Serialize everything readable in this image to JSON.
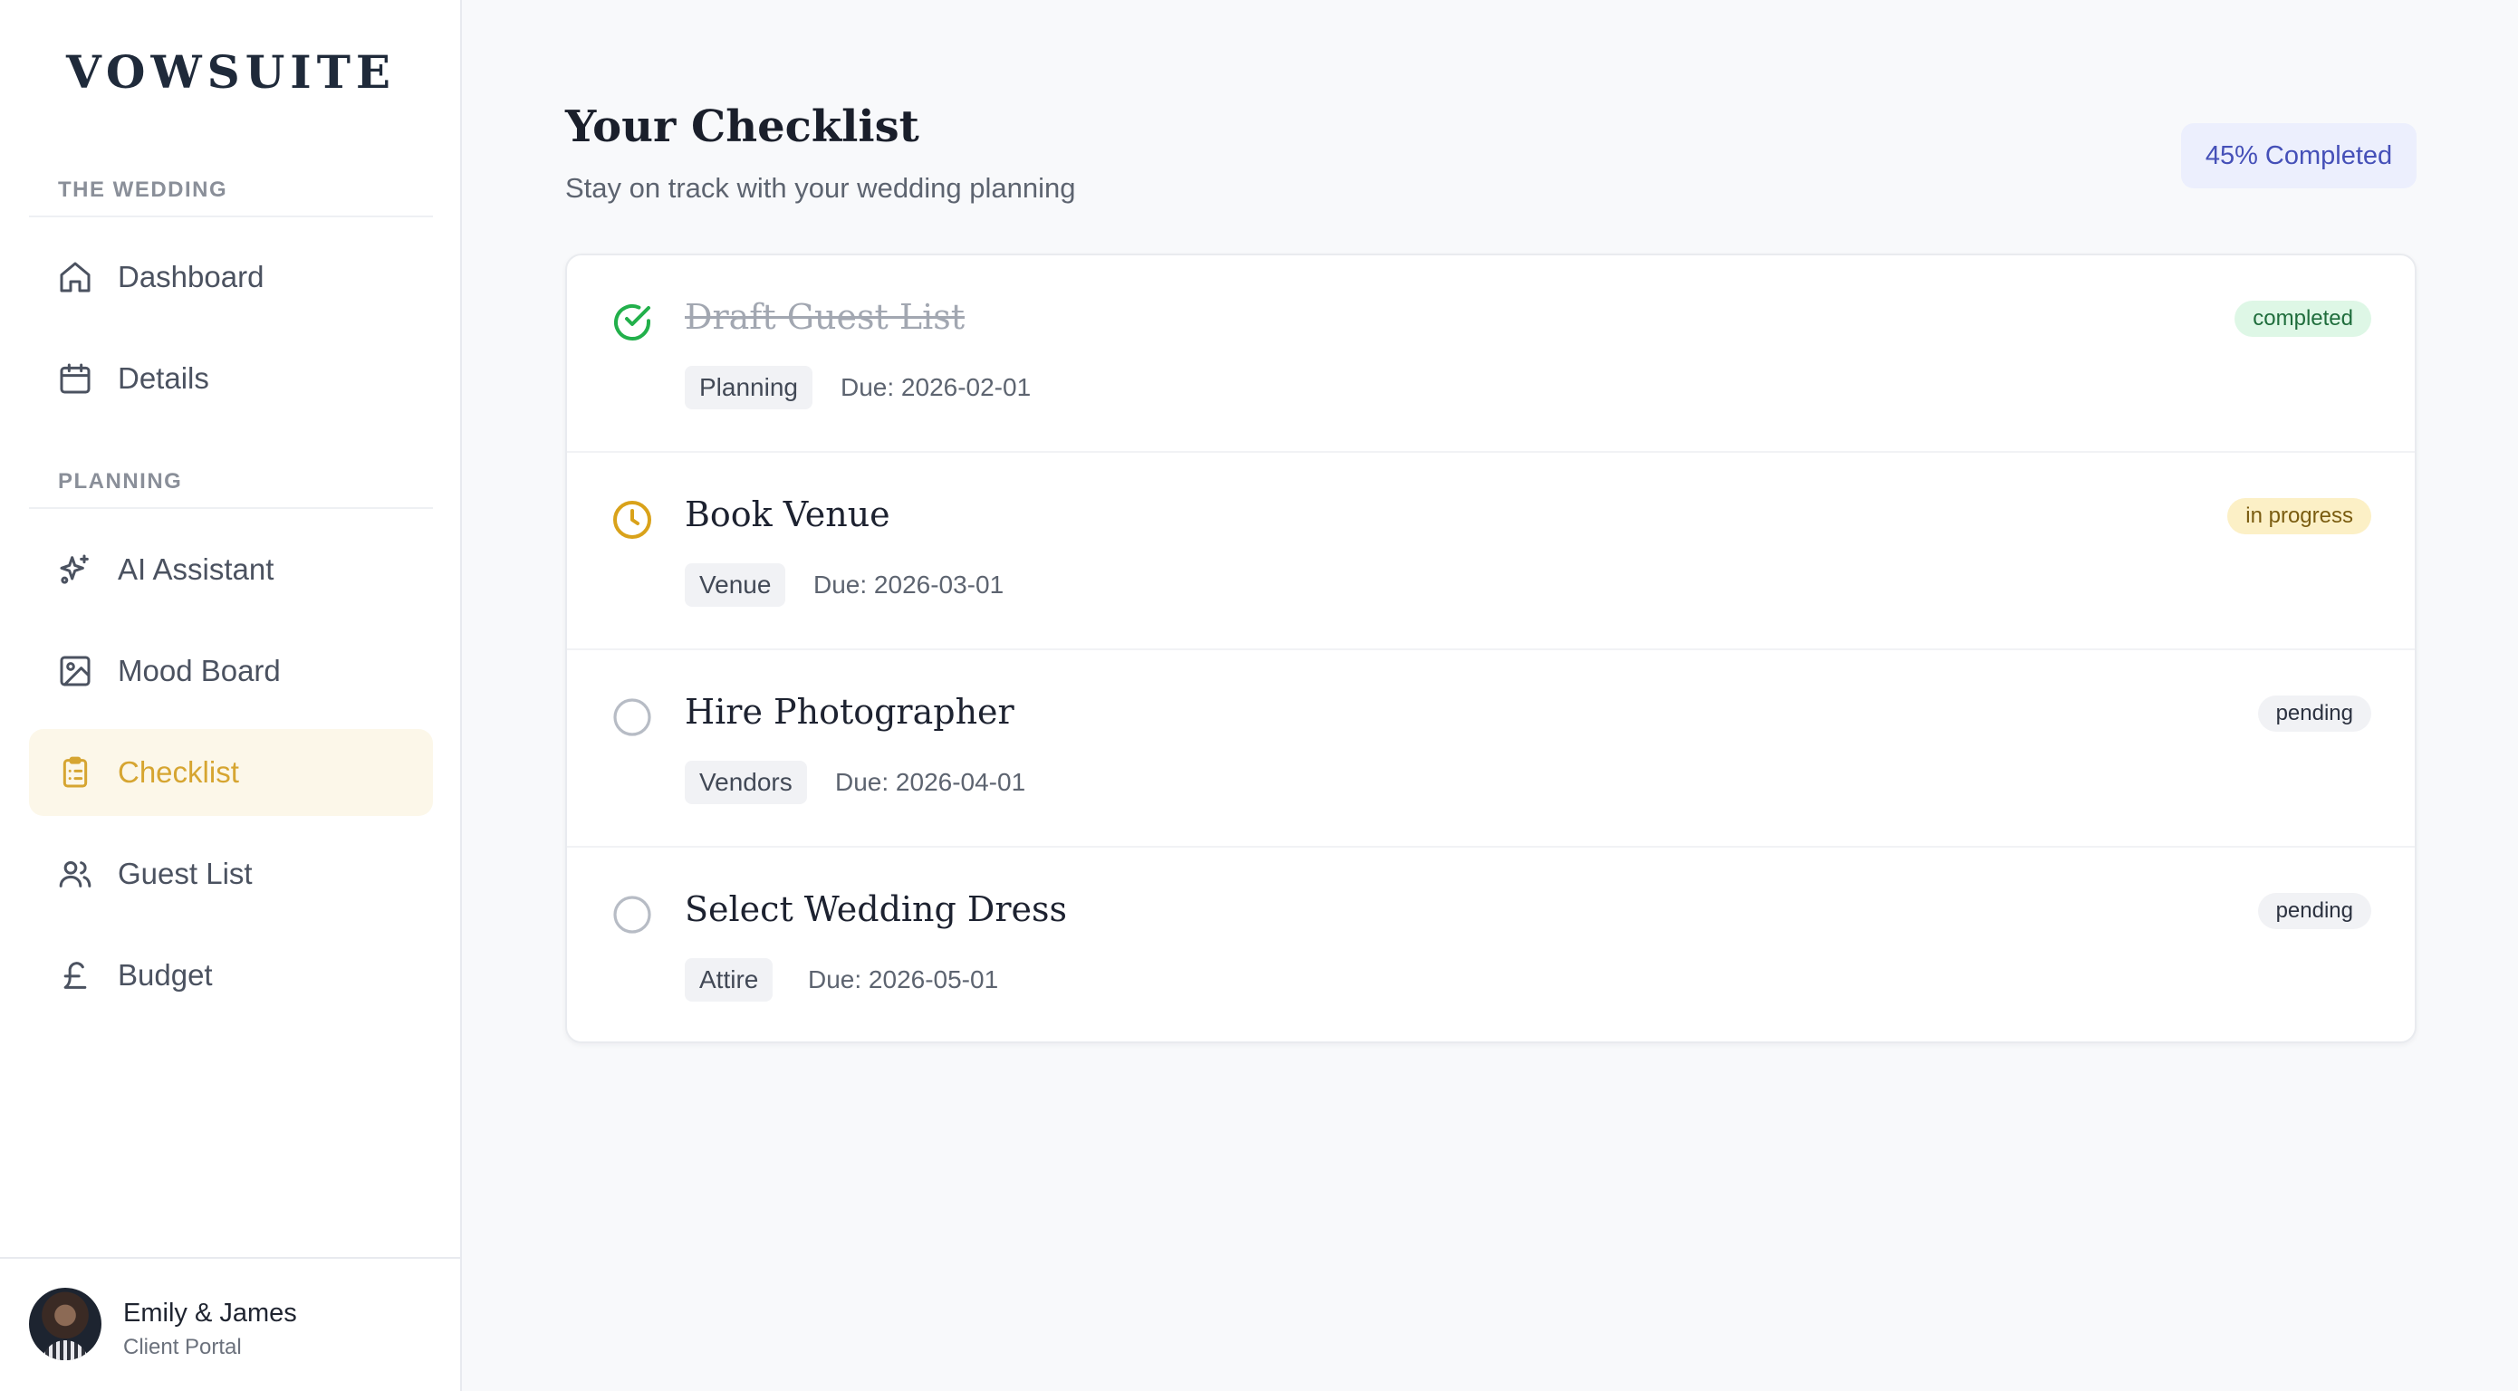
{
  "brand": {
    "logo": "VOWSUITE"
  },
  "sidebar": {
    "sections": [
      {
        "label": "THE WEDDING"
      },
      {
        "label": "PLANNING"
      }
    ],
    "items": [
      {
        "label": "Dashboard",
        "icon": "home-icon"
      },
      {
        "label": "Details",
        "icon": "calendar-icon"
      },
      {
        "label": "AI Assistant",
        "icon": "sparkles-icon"
      },
      {
        "label": "Mood Board",
        "icon": "image-icon"
      },
      {
        "label": "Checklist",
        "icon": "clipboard-list-icon",
        "active": true
      },
      {
        "label": "Guest List",
        "icon": "users-icon"
      },
      {
        "label": "Budget",
        "icon": "pound-sterling-icon"
      }
    ],
    "user": {
      "name": "Emily & James",
      "role": "Client Portal"
    }
  },
  "header": {
    "title": "Your Checklist",
    "subtitle": "Stay on track with your wedding planning",
    "progress_label": "45% Completed",
    "progress_percent": 45
  },
  "tasks": [
    {
      "title": "Draft Guest List",
      "category": "Planning",
      "due": "Due: 2026-02-01",
      "status": "completed",
      "icon": "check-circle-icon"
    },
    {
      "title": "Book Venue",
      "category": "Venue",
      "due": "Due: 2026-03-01",
      "status": "in progress",
      "icon": "clock-icon"
    },
    {
      "title": "Hire Photographer",
      "category": "Vendors",
      "due": "Due: 2026-04-01",
      "status": "pending",
      "icon": "empty-circle-icon"
    },
    {
      "title": "Select Wedding Dress",
      "category": "Attire",
      "due": "Due: 2026-05-01",
      "status": "pending",
      "icon": "empty-circle-icon"
    }
  ],
  "colors": {
    "accent_gold": "#d6a531",
    "completed_green": "#22b04b",
    "in_progress_amber": "#d9a21a",
    "progress_badge_text": "#4550b8"
  }
}
